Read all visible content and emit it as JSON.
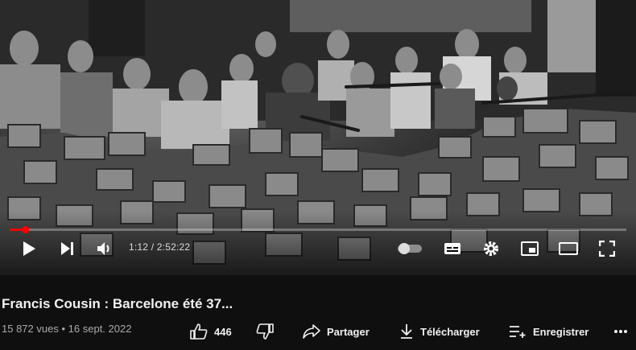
{
  "video": {
    "scene_description_icon": "barricade-photo",
    "progress_fraction": 0.025,
    "time_current": "1:12",
    "time_separator": "/",
    "time_total": "2:52:22"
  },
  "info": {
    "title": "Francis Cousin : Barcelone été 37...",
    "views": "15 872 vues",
    "separator": "•",
    "date": "16 sept. 2022"
  },
  "actions": {
    "likes_count": "446",
    "share_label": "Partager",
    "download_label": "Télécharger",
    "save_label": "Enregistrer"
  },
  "colors": {
    "progress": "#ff0000",
    "background": "#0f0f0f",
    "text": "#f1f1f1",
    "meta_text": "#aaaaaa"
  }
}
